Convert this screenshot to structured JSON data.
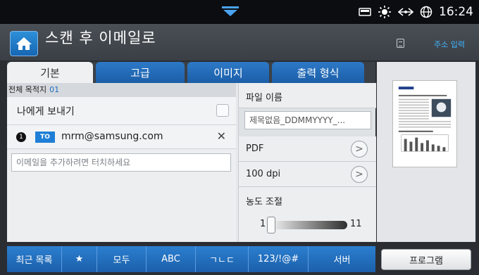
{
  "status_bar": {
    "time": "16:24"
  },
  "header": {
    "title": "스캔 후 이메일로",
    "address_entry": "주소 입력"
  },
  "tabs": [
    {
      "label": "기본",
      "active": true
    },
    {
      "label": "고급",
      "active": false
    },
    {
      "label": "이미지",
      "active": false
    },
    {
      "label": "출력 형식",
      "active": false
    }
  ],
  "destinations": {
    "header_label": "전체 목적지",
    "count": "01",
    "send_to_me_label": "나에게 보내기",
    "recipients": [
      {
        "index": "1",
        "type": "TO",
        "address": "mrm@samsung.com"
      }
    ],
    "add_placeholder": "이메일을 추가하려면 터치하세요"
  },
  "settings": {
    "file_name_label": "파일 이름",
    "file_name_value": "제목없음_DDMMYYYY_...",
    "format": "PDF",
    "resolution": "100 dpi",
    "density_label": "농도 조절",
    "density_min": "1",
    "density_max": "11",
    "density_value": 1
  },
  "keyboard_bar": [
    "최근 목록",
    "★",
    "모두",
    "ABC",
    "ㄱㄴㄷ",
    "123/!@#",
    "서버"
  ],
  "program_button": "프로그램",
  "colors": {
    "accent_blue": "#1f6fc4",
    "title_bar": "#3e4349",
    "status_bar": "#0b0d10"
  },
  "icons": {
    "home": "home-icon",
    "checkbox": "checkbox-icon",
    "remove": "close-icon",
    "next": "chevron-right-icon"
  }
}
